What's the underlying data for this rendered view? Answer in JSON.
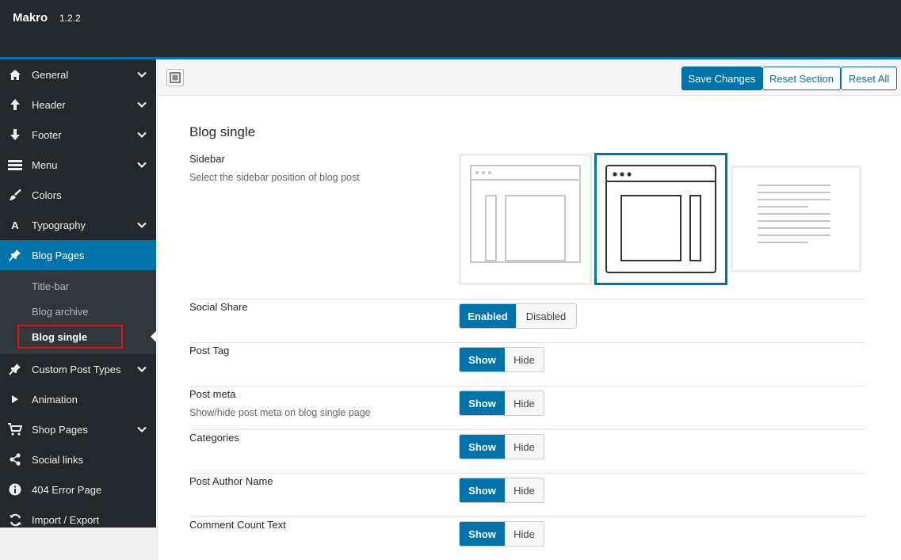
{
  "app": {
    "title": "Makro",
    "version": "1.2.2"
  },
  "sidebar": {
    "items": [
      {
        "label": "General",
        "icon": "home-icon",
        "has_children": true
      },
      {
        "label": "Header",
        "icon": "arrow-up-icon",
        "has_children": true
      },
      {
        "label": "Footer",
        "icon": "arrow-down-icon",
        "has_children": true
      },
      {
        "label": "Menu",
        "icon": "menu-icon",
        "has_children": true
      },
      {
        "label": "Colors",
        "icon": "brush-icon",
        "has_children": false
      },
      {
        "label": "Typography",
        "icon": "font-icon",
        "has_children": true
      },
      {
        "label": "Blog Pages",
        "icon": "pin-icon",
        "has_children": false,
        "active": true
      },
      {
        "label": "Custom Post Types",
        "icon": "pin-icon",
        "has_children": true
      },
      {
        "label": "Animation",
        "icon": "play-icon",
        "has_children": false
      },
      {
        "label": "Shop Pages",
        "icon": "cart-icon",
        "has_children": true
      },
      {
        "label": "Social links",
        "icon": "share-icon",
        "has_children": false
      },
      {
        "label": "404 Error Page",
        "icon": "info-icon",
        "has_children": false
      },
      {
        "label": "Import / Export",
        "icon": "refresh-icon",
        "has_children": false
      }
    ],
    "subitems": [
      {
        "label": "Title-bar"
      },
      {
        "label": "Blog archive"
      },
      {
        "label": "Blog single",
        "current": true
      }
    ]
  },
  "toolbar": {
    "save_label": "Save Changes",
    "reset_section_label": "Reset Section",
    "reset_all_label": "Reset All"
  },
  "section": {
    "title": "Blog single",
    "fields": [
      {
        "label": "Sidebar",
        "description": "Select the sidebar position of blog post",
        "options": [
          "left-sidebar",
          "right-sidebar",
          "no-sidebar"
        ],
        "selected": "right-sidebar"
      },
      {
        "label": "Social Share",
        "description": "",
        "options": [
          "Enabled",
          "Disabled"
        ],
        "selected": "Enabled"
      },
      {
        "label": "Post Tag",
        "description": "",
        "options": [
          "Show",
          "Hide"
        ],
        "selected": "Show"
      },
      {
        "label": "Post meta",
        "description": "Show/hide post meta on blog single page",
        "options": [
          "Show",
          "Hide"
        ],
        "selected": "Show"
      },
      {
        "label": "Categories",
        "description": "",
        "options": [
          "Show",
          "Hide"
        ],
        "selected": "Show"
      },
      {
        "label": "Post Author Name",
        "description": "",
        "options": [
          "Show",
          "Hide"
        ],
        "selected": "Show"
      },
      {
        "label": "Comment Count Text",
        "description": "",
        "options": [
          "Show",
          "Hide"
        ],
        "selected": "Show"
      }
    ]
  },
  "colors": {
    "accent": "#0073aa",
    "sidebar_bg": "#23282d",
    "highlight": "#e3131b"
  }
}
